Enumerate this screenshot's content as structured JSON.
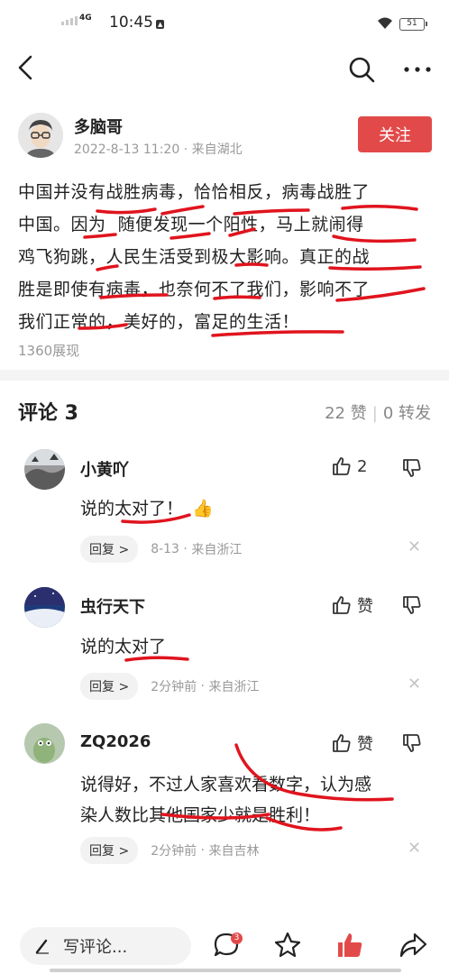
{
  "status_bar": {
    "network": "4G",
    "time": "10:45",
    "battery": "51"
  },
  "post": {
    "author_name": "多脑哥",
    "date": "2022-8-13 11:20",
    "location": "来自湖北",
    "follow_label": "关注",
    "lines": [
      "中国并没有战胜病毒，恰恰相反，病毒战胜了",
      "中国。因为  随便发现一个阳性，马上就闹得",
      "鸡飞狗跳，人民生活受到极大影响。真正的战",
      "胜是即使有病毒，也奈何不了我们，影响不了",
      "我们正常的，美好的，富足的生活！"
    ],
    "views": "1360展现"
  },
  "comments_header": {
    "title": "评论 3",
    "likes": "22 赞",
    "shares": "0 转发"
  },
  "comments": [
    {
      "name": "小黄吖",
      "like": "2",
      "text": "说的太对了！",
      "emoji": "👍",
      "reply_label": "回复 >",
      "time": "8-13",
      "location": "来自浙江"
    },
    {
      "name": "虫行天下",
      "like": "赞",
      "text": "说的太对了",
      "reply_label": "回复 >",
      "time": "2分钟前",
      "location": "来自浙江"
    },
    {
      "name": "ZQ2026",
      "like": "赞",
      "text_lines": [
        "说得好，不过人家喜欢看数字，认为感",
        "染人数比其他国家少就是胜利！"
      ],
      "reply_label": "回复 >",
      "time": "2分钟前",
      "location": "来自吉林"
    }
  ],
  "bottom_bar": {
    "write_placeholder": "写评论...",
    "comment_badge": "3"
  },
  "colors": {
    "accent": "#e24a4a",
    "meta": "#999999",
    "ink_annotation": "#e0141e"
  },
  "icons": [
    "back-icon",
    "search-icon",
    "more-icon",
    "thumb-up-icon",
    "thumb-down-icon",
    "close-icon",
    "pen-icon",
    "comment-icon",
    "star-icon",
    "like-filled-icon",
    "share-icon"
  ]
}
